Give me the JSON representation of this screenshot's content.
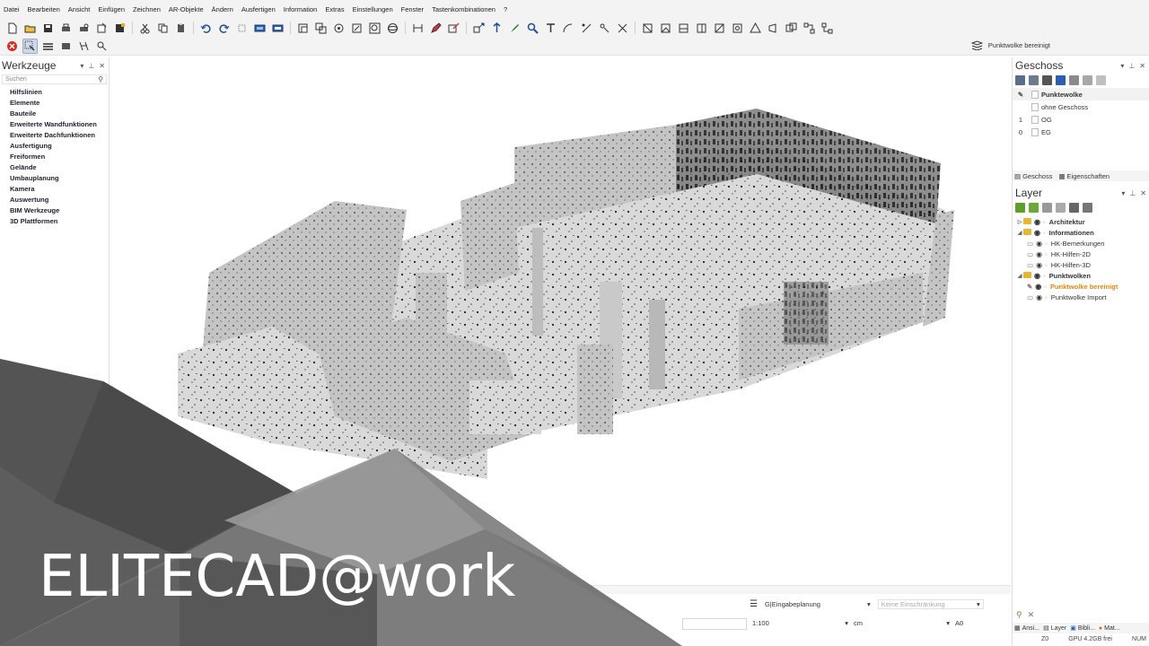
{
  "menu": [
    "Datei",
    "Bearbeiten",
    "Ansicht",
    "Einfügen",
    "Zeichnen",
    "AR-Objekte",
    "Ändern",
    "Ausfertigen",
    "Information",
    "Extras",
    "Einstellungen",
    "Fenster",
    "Tastenkombinationen",
    "?"
  ],
  "toolbar": {
    "active_layer": "Punktwolke bereinigt"
  },
  "tools_panel": {
    "title": "Werkzeuge",
    "search_placeholder": "Suchen",
    "items": [
      "Hilfslinien",
      "Elemente",
      "Bauteile",
      "Erweiterte Wandfunktionen",
      "Erweiterte Dachfunktionen",
      "Ausfertigung",
      "Freiformen",
      "Gelände",
      "Umbauplanung",
      "Kamera",
      "Auswertung",
      "BIM Werkzeuge",
      "3D Plattformen"
    ]
  },
  "geschoss_panel": {
    "title": "Geschoss",
    "rows": [
      {
        "num": "",
        "label": "Punktewolke",
        "selected": true
      },
      {
        "num": "",
        "label": "ohne Geschoss",
        "selected": false
      },
      {
        "num": "1",
        "label": "OG",
        "selected": false
      },
      {
        "num": "0",
        "label": "EG",
        "selected": false
      }
    ],
    "tabs": [
      "Geschoss",
      "Eigenschaften"
    ]
  },
  "layer_panel": {
    "title": "Layer",
    "rows": [
      {
        "label": "Architektur",
        "level": 0,
        "header": true,
        "active": false,
        "expanded": false
      },
      {
        "label": "Informationen",
        "level": 0,
        "header": true,
        "active": false,
        "expanded": true
      },
      {
        "label": "HK-Bemerkungen",
        "level": 1,
        "header": false,
        "active": false
      },
      {
        "label": "HK-Hilfen-2D",
        "level": 1,
        "header": false,
        "active": false
      },
      {
        "label": "HK-Hilfen-3D",
        "level": 1,
        "header": false,
        "active": false
      },
      {
        "label": "Punktwolken",
        "level": 0,
        "header": true,
        "active": false,
        "expanded": true
      },
      {
        "label": "Punktwolke bereinigt",
        "level": 1,
        "header": false,
        "active": true
      },
      {
        "label": "Punktwolke Import",
        "level": 1,
        "header": false,
        "active": false
      }
    ]
  },
  "bottom_tabs": [
    "Ansi...",
    "Layer",
    "Bibli...",
    "Mat..."
  ],
  "status": {
    "plan": "G|Eingabeplanung",
    "restriction_placeholder": "Keine Einschränkung",
    "scale": "1:100",
    "unit": "cm",
    "paper": "A0",
    "z": "Z0",
    "gpu": "GPU 4.2GB frei",
    "num": "NUM"
  },
  "brand": "ELITECAD@work",
  "colors": {
    "accent_active_layer": "#e08a16",
    "folder": "#e8b630",
    "overlay_dark": "#3c3c3c",
    "overlay_mid": "#6b6b6b",
    "overlay_light": "#9a9a9a"
  }
}
